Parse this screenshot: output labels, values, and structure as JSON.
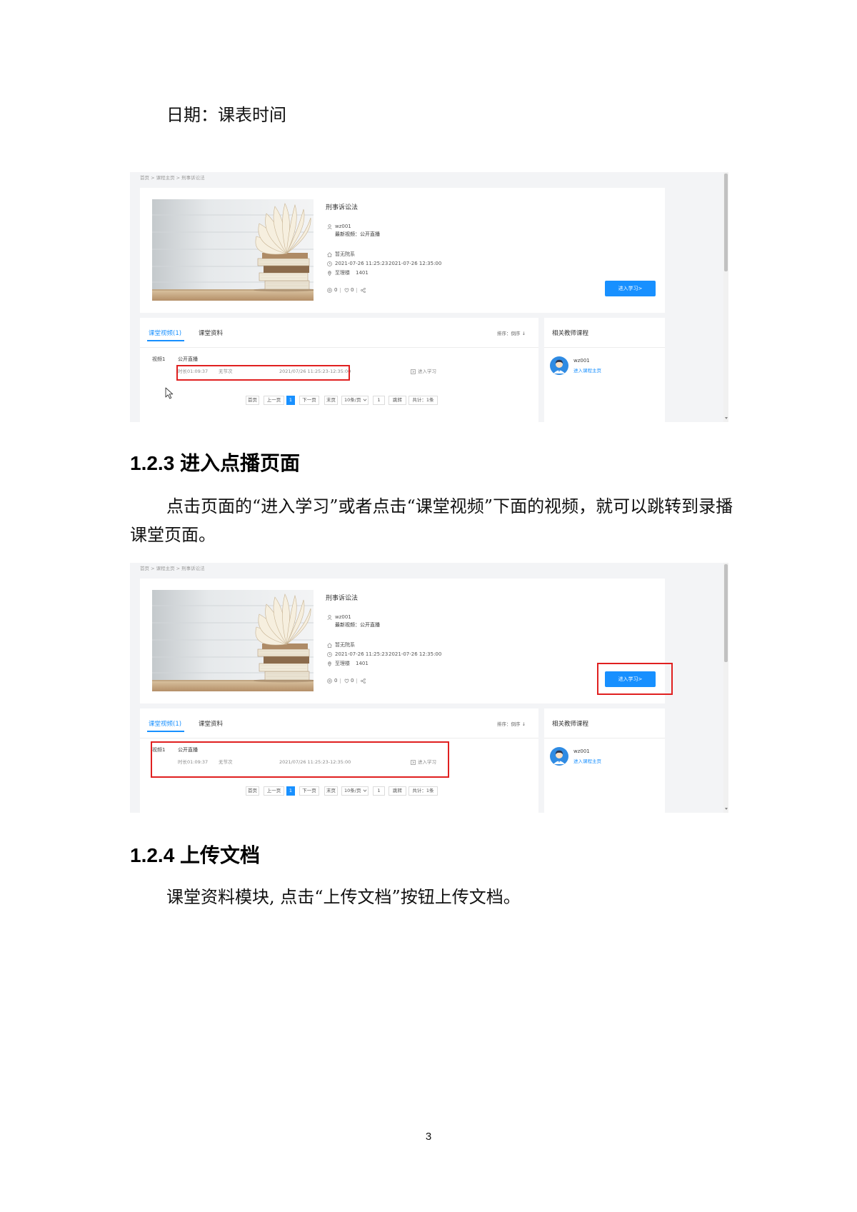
{
  "document": {
    "intro_line": "日期：课表时间",
    "sections": [
      {
        "heading": "1.2.3 进入点播页面",
        "paragraph": "点击页面的“进入学习”或者点击“课堂视频”下面的视频，就可以跳转到录播课堂页面。"
      },
      {
        "heading": "1.2.4 上传文档",
        "paragraph": "课堂资料模块, 点击“上传文档”按钮上传文档。"
      }
    ],
    "page_number": "3"
  },
  "course_page": {
    "breadcrumb": "首页 > 课程主页 > 刑事诉讼法",
    "course_title": "刑事诉讼法",
    "teacher": "wz001",
    "latest_video": "最新视频：公开直播",
    "department": "暂无院系",
    "start_time": "2021-07-26 11:25:23",
    "end_time": "2021-07-26 12:35:00",
    "building": "至理楼",
    "room": "1401",
    "views": "0",
    "likes": "0",
    "enter_button": "进入学习>",
    "tabs": [
      {
        "label": "课堂视频(1)",
        "active": true
      },
      {
        "label": "课堂资料",
        "active": false
      }
    ],
    "sort_label": "排序：倒序 ↓",
    "videos": [
      {
        "index": "视频1",
        "title": "公开直播",
        "duration": "时长01:09:37",
        "section": "无节次",
        "time_range": "2021/07/26 11:25:23-12:35:00",
        "action": "进入学习"
      }
    ],
    "pagination": {
      "first": "首页",
      "prev": "上一页",
      "current": "1",
      "next": "下一页",
      "last": "末页",
      "page_size": "10条/页",
      "jump_value": "1",
      "jump": "跳转",
      "total": "共计：1条"
    },
    "related": {
      "title": "相关教师课程",
      "teacher": "wz001",
      "link": "进入课程主页"
    },
    "icons": [
      "user-icon",
      "home-icon",
      "clock-icon",
      "location-icon",
      "eye-icon",
      "heart-icon",
      "share-icon",
      "play-box-icon",
      "chevron-down-icon",
      "avatar",
      "mouse-cursor"
    ]
  },
  "colors": {
    "accent": "#1890ff",
    "annotation": "#e02020"
  }
}
